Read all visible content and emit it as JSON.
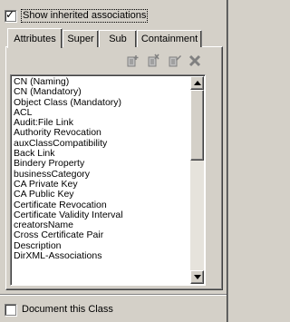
{
  "show_inherited": {
    "label": "Show inherited associations",
    "checked": true
  },
  "tabs": [
    {
      "label": "Attributes",
      "active": true
    },
    {
      "label": "Super",
      "active": false
    },
    {
      "label": "Sub",
      "active": false
    },
    {
      "label": "Containment",
      "active": false
    }
  ],
  "toolbar": {
    "icons": [
      "add-attribute-icon",
      "add-optional-icon",
      "edit-attribute-icon",
      "delete-icon"
    ]
  },
  "attributes": [
    "CN (Naming)",
    "CN (Mandatory)",
    "Object Class (Mandatory)",
    "ACL",
    "Audit:File Link",
    "Authority Revocation",
    "auxClassCompatibility",
    "Back Link",
    "Bindery Property",
    "businessCategory",
    "CA Private Key",
    "CA Public Key",
    "Certificate Revocation",
    "Certificate Validity Interval",
    "creatorsName",
    "Cross Certificate Pair",
    "Description",
    "DirXML-Associations"
  ],
  "document_class": {
    "label": "Document this Class",
    "checked": false
  }
}
